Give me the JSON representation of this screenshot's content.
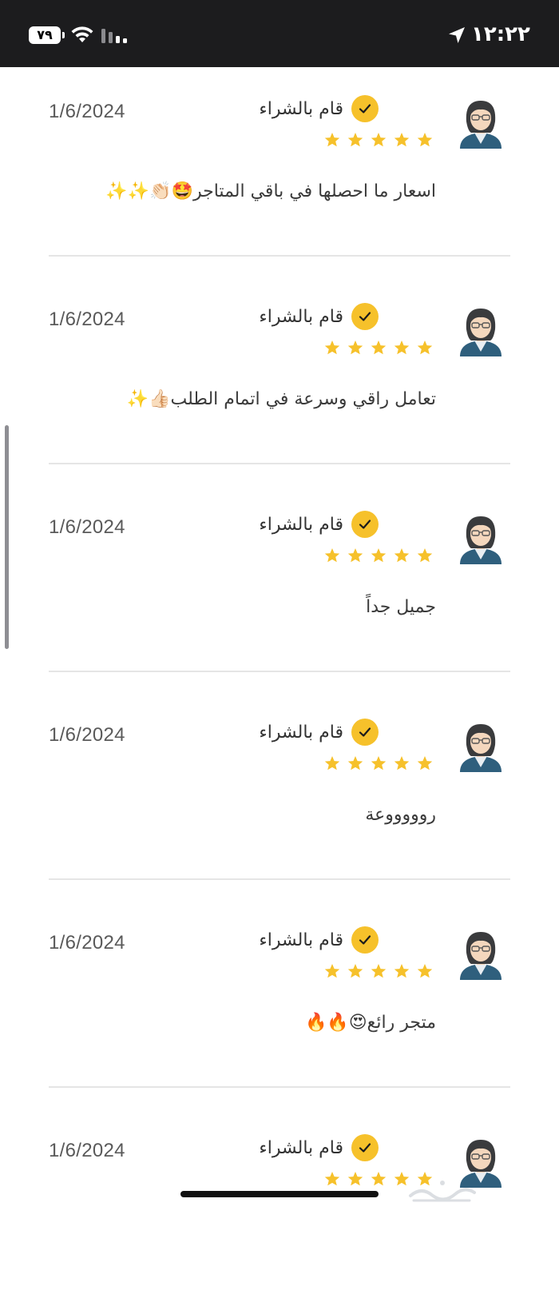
{
  "status_bar": {
    "time": "١٢:٢٢",
    "battery": "٧٩"
  },
  "colors": {
    "accent": "#f6c12b",
    "status_bar_bg": "#1c1c1e",
    "divider": "#e5e5e5"
  },
  "icons": {
    "verified": "checkmark-badge-icon",
    "rating": "star-icon",
    "avatar": "woman-with-glasses-avatar-icon"
  },
  "reviews": [
    {
      "name": "قام بالشراء",
      "date": "1/6/2024",
      "rating": 5,
      "comment": "اسعار ما احصلها في باقي المتاجر🤩👏🏻✨✨"
    },
    {
      "name": "قام بالشراء",
      "date": "1/6/2024",
      "rating": 5,
      "comment": "تعامل راقي وسرعة في اتمام الطلب👍🏻✨"
    },
    {
      "name": "قام بالشراء",
      "date": "1/6/2024",
      "rating": 5,
      "comment": "جميل جداً"
    },
    {
      "name": "قام بالشراء",
      "date": "1/6/2024",
      "rating": 5,
      "comment": "روووووعة"
    },
    {
      "name": "قام بالشراء",
      "date": "1/6/2024",
      "rating": 5,
      "comment": "متجر رائع😍🔥🔥"
    },
    {
      "name": "قام بالشراء",
      "date": "1/6/2024",
      "rating": 5,
      "comment": ""
    }
  ],
  "watermark": "حراج"
}
